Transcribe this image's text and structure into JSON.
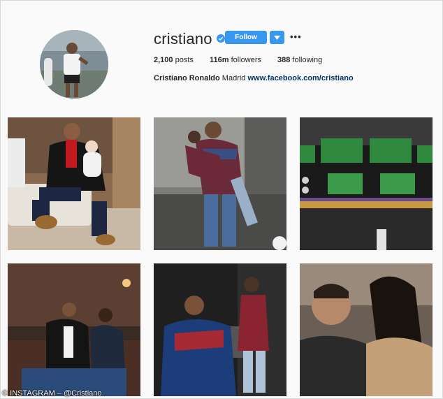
{
  "profile": {
    "username": "cristiano",
    "follow_label": "Follow",
    "more_label": "•••",
    "stats": {
      "posts": "2,100",
      "posts_label": "posts",
      "followers": "116m",
      "followers_label": "followers",
      "following": "388",
      "following_label": "following"
    },
    "bio": {
      "name": "Cristiano Ronaldo",
      "location": "Madrid",
      "link": "www.facebook.com/cristiano"
    }
  },
  "icons": [
    "verified-badge-icon",
    "chevron-down-icon",
    "more-options-icon"
  ],
  "colors": {
    "accent": "#3897f0",
    "link": "#003569",
    "background": "#fafafa"
  },
  "credit": "© INSTAGRAM – @Cristiano"
}
